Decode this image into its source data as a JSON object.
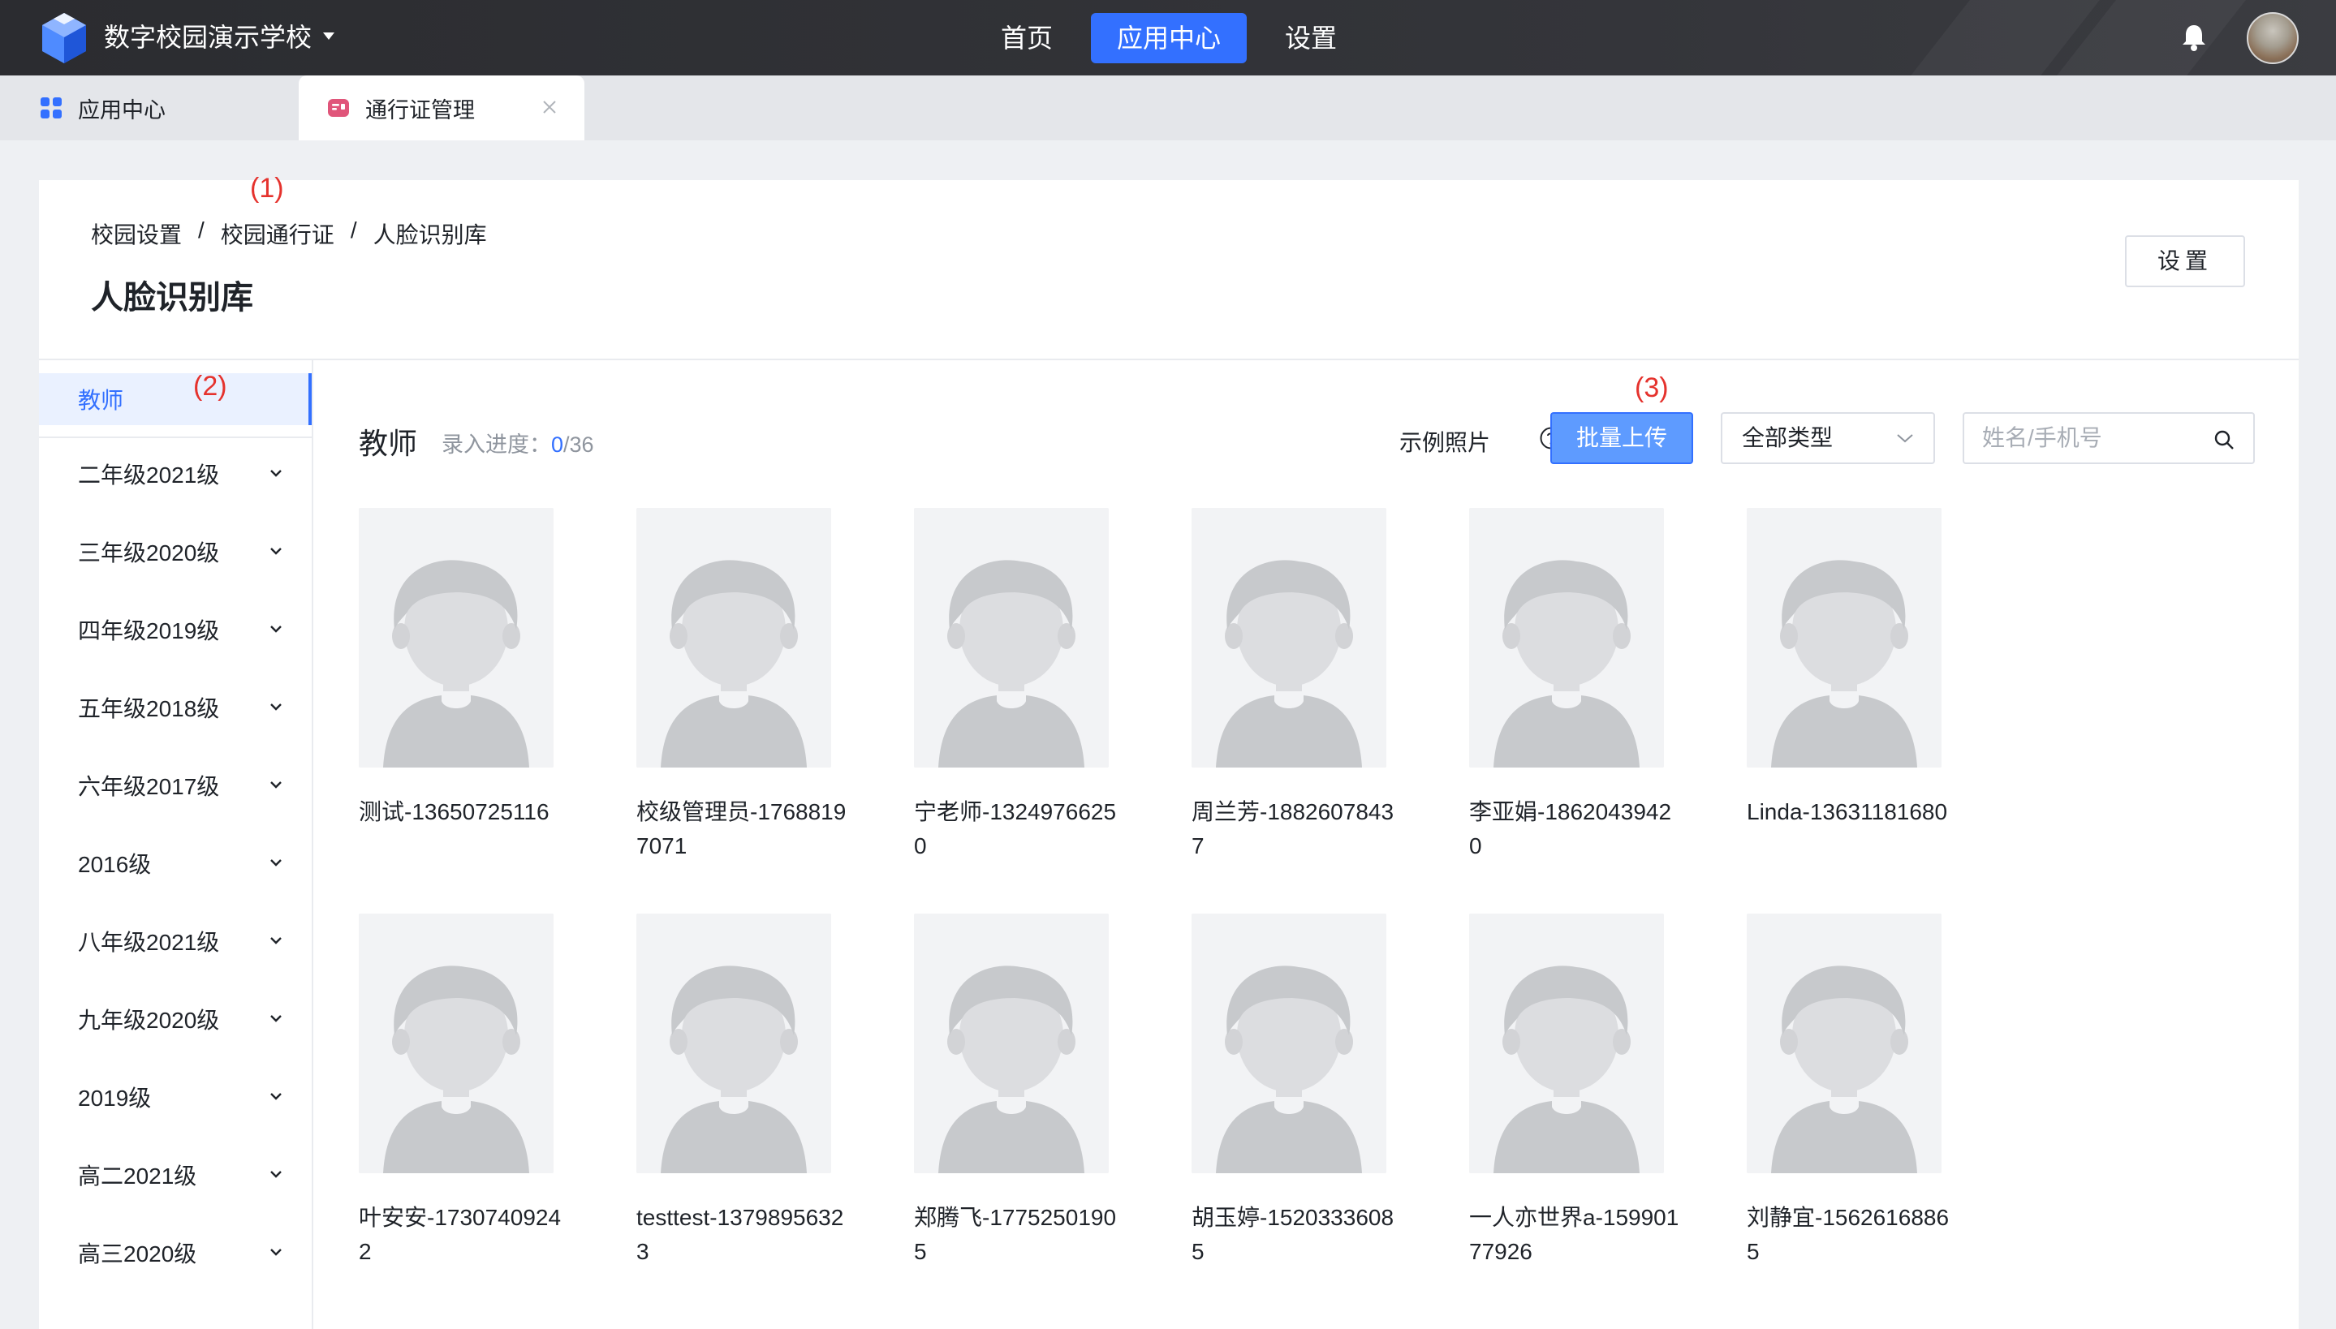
{
  "header": {
    "school_name": "数字校园演示学校",
    "nav": [
      "首页",
      "应用中心",
      "设置"
    ],
    "active_nav": "应用中心",
    "accent_color": "#3370ff"
  },
  "tabs": [
    {
      "label": "应用中心",
      "icon": "apps-grid-icon"
    },
    {
      "label": "通行证管理",
      "icon": "id-card-icon"
    }
  ],
  "annotations": [
    "(1)",
    "(2)",
    "(3)"
  ],
  "breadcrumb": [
    "校园设置",
    "校园通行证",
    "人脸识别库"
  ],
  "breadcrumb_sep": "/",
  "page_title": "人脸识别库",
  "settings_label": "设置",
  "sidebar": {
    "items": [
      "教师",
      "二年级2021级",
      "三年级2020级",
      "四年级2019级",
      "五年级2018级",
      "六年级2017级",
      "2016级",
      "八年级2021级",
      "九年级2020级",
      "2019级",
      "高二2021级",
      "高三2020级"
    ],
    "active": "教师"
  },
  "content": {
    "title": "教师",
    "progress_label": "录入进度：",
    "progress_done": "0",
    "progress_total": "/36",
    "sample_photo_label": "示例照片",
    "upload_label": "批量上传",
    "type_select": "全部类型",
    "search_placeholder": "姓名/手机号"
  },
  "people": [
    "测试-13650725116",
    "校级管理员-17688197071",
    "宁老师-13249766250",
    "周兰芳-18826078437",
    "李亚娟-18620439420",
    "Linda-13631181680",
    "叶安安-17307409242",
    "testtest-13798956323",
    "郑腾飞-17752501905",
    "胡玉婷-15203336085",
    "一人亦世界a-15990177926",
    "刘静宜-15626168865"
  ]
}
